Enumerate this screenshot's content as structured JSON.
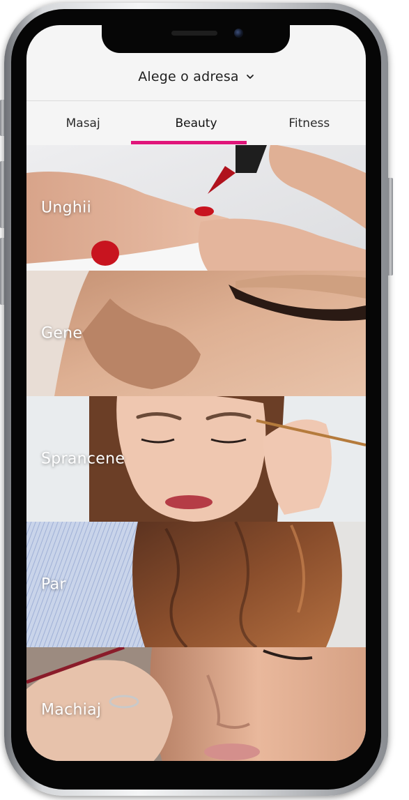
{
  "header": {
    "address_label": "Alege o adresa",
    "address_icon": "chevron-down-icon"
  },
  "tabs": [
    {
      "label": "Masaj",
      "active": false
    },
    {
      "label": "Beauty",
      "active": true
    },
    {
      "label": "Fitness",
      "active": false
    }
  ],
  "accent_color": "#e0157a",
  "categories": [
    {
      "label": "Unghii",
      "image": "nail-polish-photo"
    },
    {
      "label": "Gene",
      "image": "eyelash-photo"
    },
    {
      "label": "Sprancene",
      "image": "eyebrow-photo"
    },
    {
      "label": "Par",
      "image": "hair-photo"
    },
    {
      "label": "Machiaj",
      "image": "makeup-photo"
    }
  ]
}
